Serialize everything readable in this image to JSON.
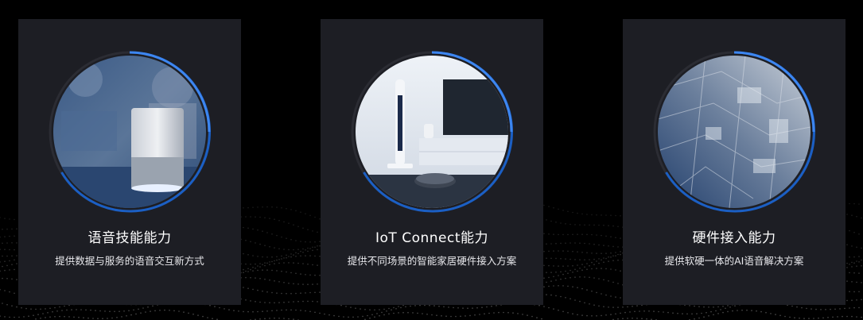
{
  "cards": [
    {
      "title": "语音技能能力",
      "description": "提供数据与服务的语音交互新方式",
      "image": "smart-speaker-photo"
    },
    {
      "title": "IoT Connect能力",
      "description": "提供不同场景的智能家居硬件接入方案",
      "image": "smart-home-photo"
    },
    {
      "title": "硬件接入能力",
      "description": "提供软硬一体的AI语音解决方案",
      "image": "circuit-board-photo"
    }
  ],
  "colors": {
    "background": "#000000",
    "card": "#1d1e24",
    "ring": "#1f6fd8",
    "text": "#ffffff"
  }
}
